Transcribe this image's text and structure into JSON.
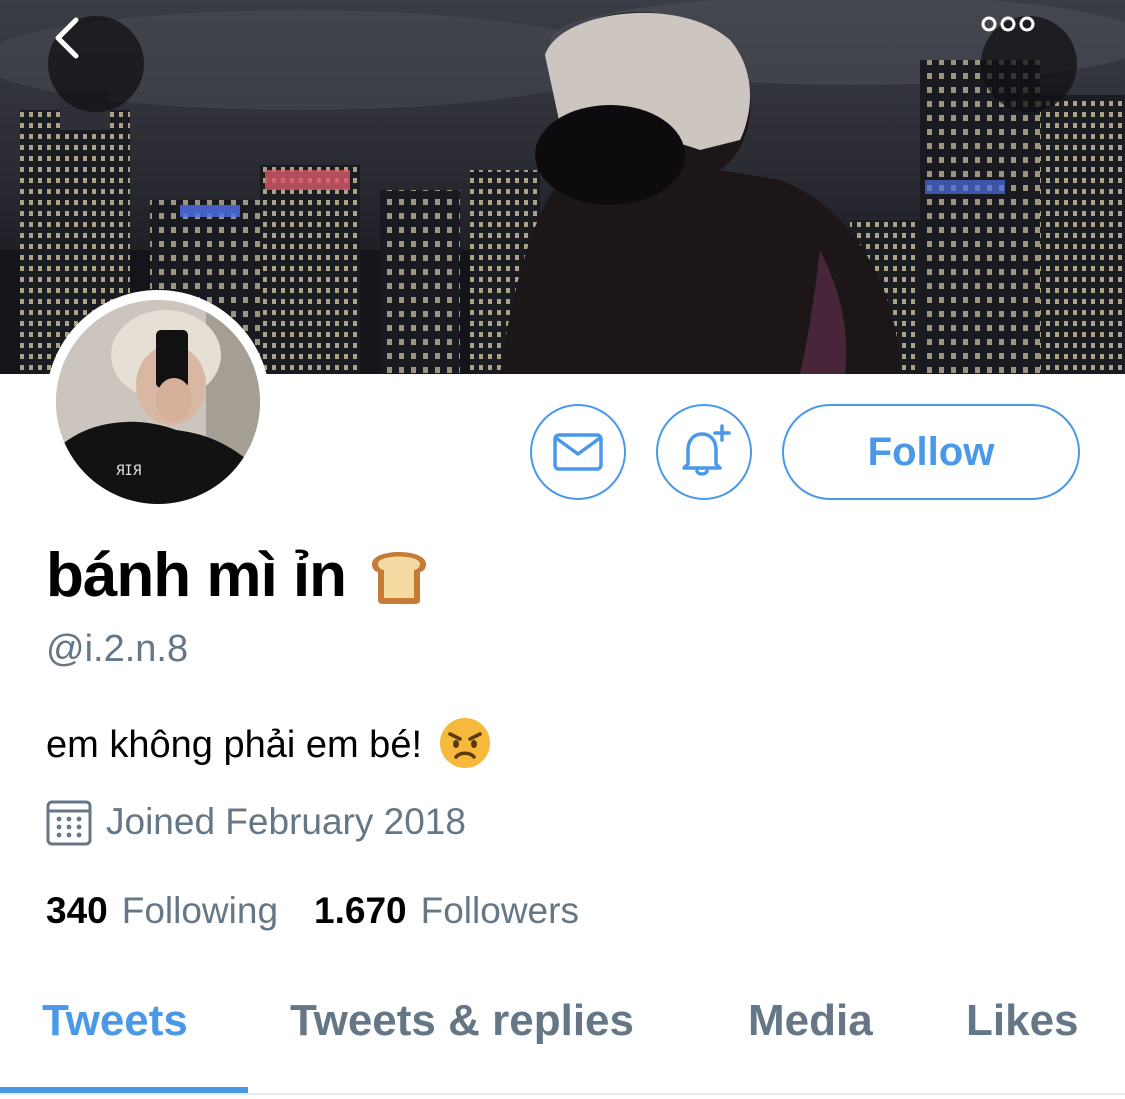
{
  "profile": {
    "name": "bánh mì ỉn",
    "name_emoji": "bread-emoji",
    "handle": "@i.2.n.8",
    "bio": "em không phải em bé!",
    "bio_emoji": "angry-face-emoji",
    "joined": "Joined February 2018"
  },
  "stats": {
    "following_count": "340",
    "following_label": "Following",
    "followers_count": "1.670",
    "followers_label": "Followers"
  },
  "actions": {
    "follow_label": "Follow",
    "message_icon": "envelope-icon",
    "notify_icon": "bell-plus-icon"
  },
  "header": {
    "back_icon": "chevron-left-icon",
    "more_icon": "more-dots-icon"
  },
  "tabs": [
    {
      "label": "Tweets",
      "active": true
    },
    {
      "label": "Tweets & replies",
      "active": false
    },
    {
      "label": "Media",
      "active": false
    },
    {
      "label": "Likes",
      "active": false
    }
  ],
  "colors": {
    "accent": "#4a99e9",
    "secondary_text": "#657786",
    "primary_text": "#000000"
  }
}
